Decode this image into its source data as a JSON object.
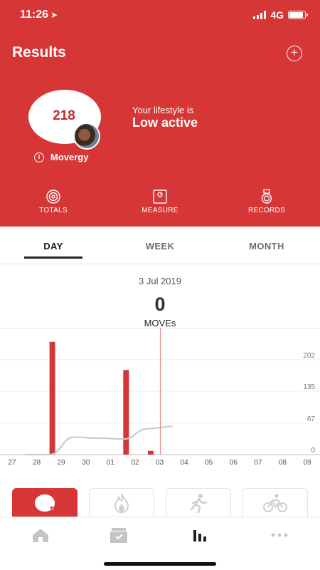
{
  "status_bar": {
    "time": "11:26",
    "location_glyph": "➤",
    "network": "4G",
    "battery_level": 0.9
  },
  "header": {
    "title": "Results",
    "background_color": "#d63636",
    "add_icon": "plus-circle-icon",
    "score": {
      "value": "218",
      "label": "Movergy",
      "info_glyph": "i"
    },
    "lifestyle": {
      "prefix": "Your lifestyle is",
      "value": "Low active"
    },
    "actions": [
      {
        "label": "TOTALS",
        "icon": "totals-icon"
      },
      {
        "label": "MEASURE",
        "icon": "scale-icon"
      },
      {
        "label": "RECORDS",
        "icon": "medal-icon"
      }
    ]
  },
  "tabs": {
    "items": [
      "DAY",
      "WEEK",
      "MONTH"
    ],
    "selected": "DAY"
  },
  "summary": {
    "date": "3 Jul 2019",
    "moves_value": "0",
    "moves_unit": "MOVEs"
  },
  "chart_data": {
    "type": "bar",
    "categories": [
      "27",
      "28",
      "29",
      "30",
      "01",
      "02",
      "03",
      "04",
      "05",
      "06",
      "07",
      "08",
      "09"
    ],
    "values": [
      0,
      240,
      0,
      0,
      180,
      8,
      0,
      null,
      null,
      null,
      null,
      null,
      null
    ],
    "series": [
      {
        "values": [
          0,
          240,
          0,
          0,
          180,
          8,
          0,
          null,
          null,
          null,
          null,
          null,
          null
        ],
        "color": "#d63636"
      }
    ],
    "trend": {
      "values": [
        0,
        0,
        37,
        35,
        33,
        55,
        60,
        null,
        null,
        null,
        null,
        null,
        null
      ],
      "color": "#c8cccc"
    },
    "ylim": [
      0,
      270
    ],
    "yticks": [
      0,
      67,
      135,
      202
    ],
    "selected_category": "03",
    "grid": true
  },
  "categories": [
    {
      "icon": "movergy-icon",
      "active": true
    },
    {
      "icon": "flame-icon",
      "active": false
    },
    {
      "icon": "running-icon",
      "active": false
    },
    {
      "icon": "cycling-icon",
      "active": false
    }
  ],
  "bottom_nav": [
    {
      "icon": "home-icon",
      "active": false
    },
    {
      "icon": "inbox-icon",
      "active": false
    },
    {
      "icon": "bar-chart-icon",
      "active": true
    },
    {
      "icon": "more-icon",
      "active": false
    }
  ]
}
